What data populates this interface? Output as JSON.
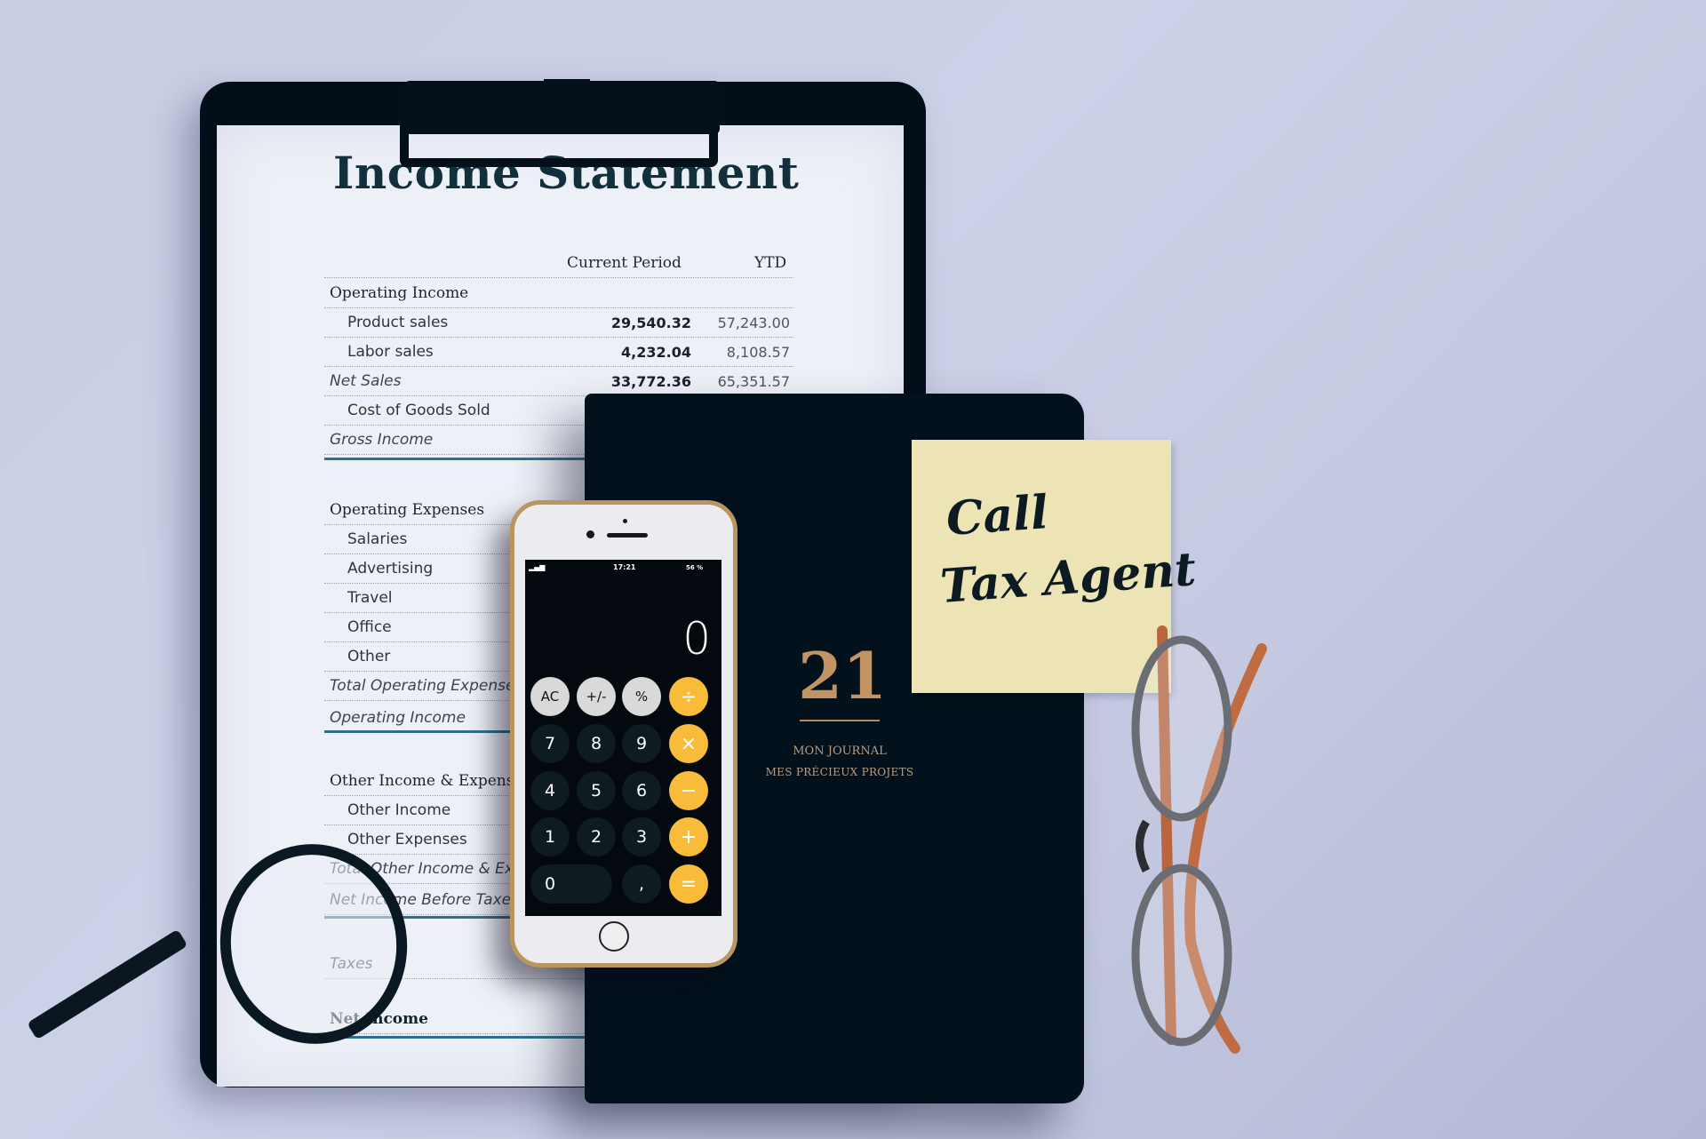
{
  "scene": {
    "description": "Flat-lay desk scene with income statement on clipboard, phone calculator, journal, sticky note, glasses and magnifying glass",
    "background_color": "#c9cde3"
  },
  "income_statement": {
    "title": "Income Statement",
    "columns": [
      "Current Period",
      "YTD"
    ],
    "rows": [
      {
        "type": "section",
        "label": "Operating Income",
        "current": "",
        "ytd": ""
      },
      {
        "type": "item",
        "label": "Product sales",
        "current": "29,540.32",
        "ytd": "57,243.00"
      },
      {
        "type": "item",
        "label": "Labor sales",
        "current": "4,232.04",
        "ytd": "8,108.57"
      },
      {
        "type": "total",
        "label": "Net Sales",
        "current": "33,772.36",
        "ytd": "65,351.57"
      },
      {
        "type": "item",
        "label": "Cost of Goods Sold",
        "current": "",
        "ytd": ""
      },
      {
        "type": "total",
        "label": "Gross Income",
        "current": "",
        "ytd": ""
      },
      {
        "type": "section",
        "label": "Operating Expenses",
        "current": "",
        "ytd": ""
      },
      {
        "type": "item",
        "label": "Salaries",
        "current": "",
        "ytd": ""
      },
      {
        "type": "item",
        "label": "Advertising",
        "current": "",
        "ytd": ""
      },
      {
        "type": "item",
        "label": "Travel",
        "current": "",
        "ytd": ""
      },
      {
        "type": "item",
        "label": "Office",
        "current": "",
        "ytd": ""
      },
      {
        "type": "item",
        "label": "Other",
        "current": "",
        "ytd": ""
      },
      {
        "type": "total",
        "label": "Total Operating Expenses",
        "current": "",
        "ytd": ""
      },
      {
        "type": "total",
        "label": "Operating Income",
        "current": "",
        "ytd": ""
      },
      {
        "type": "section",
        "label": "Other Income & Expenses",
        "current": "",
        "ytd": ""
      },
      {
        "type": "item",
        "label": "Other Income",
        "current": "",
        "ytd": ""
      },
      {
        "type": "item",
        "label": "Other Expenses",
        "current": "",
        "ytd": ""
      },
      {
        "type": "total",
        "label": "Total Other Income & Expenses",
        "current": "",
        "ytd": ""
      },
      {
        "type": "total",
        "label": "Net Income Before Taxes",
        "current": "",
        "ytd": ""
      },
      {
        "type": "total",
        "label": "Taxes",
        "current": "",
        "ytd": ""
      },
      {
        "type": "net",
        "label": "Net Income",
        "current": "",
        "ytd": ""
      }
    ]
  },
  "phone": {
    "status_time": "17:21",
    "battery": "56 %",
    "signal_icon": "signal-bars-icon",
    "display_value": "0",
    "keys": [
      {
        "label": "AC",
        "kind": "fn"
      },
      {
        "label": "+/-",
        "kind": "fn"
      },
      {
        "label": "%",
        "kind": "fn"
      },
      {
        "label": "÷",
        "kind": "op"
      },
      {
        "label": "7",
        "kind": "num"
      },
      {
        "label": "8",
        "kind": "num"
      },
      {
        "label": "9",
        "kind": "num"
      },
      {
        "label": "×",
        "kind": "op"
      },
      {
        "label": "4",
        "kind": "num"
      },
      {
        "label": "5",
        "kind": "num"
      },
      {
        "label": "6",
        "kind": "num"
      },
      {
        "label": "−",
        "kind": "op"
      },
      {
        "label": "1",
        "kind": "num"
      },
      {
        "label": "2",
        "kind": "num"
      },
      {
        "label": "3",
        "kind": "num"
      },
      {
        "label": "+",
        "kind": "op"
      },
      {
        "label": "0",
        "kind": "zero"
      },
      {
        "label": ",",
        "kind": "num"
      },
      {
        "label": "=",
        "kind": "op"
      }
    ],
    "accent_color": "#f8bc3a"
  },
  "journal": {
    "number": "21",
    "line1": "MON JOURNAL",
    "line2": "MES PRÉCIEUX PROJETS",
    "cover_color": "#02111b",
    "foil_color": "#c39463"
  },
  "sticky_note": {
    "line1": "Call",
    "line2": "Tax Agent",
    "color": "#ece4b4"
  }
}
